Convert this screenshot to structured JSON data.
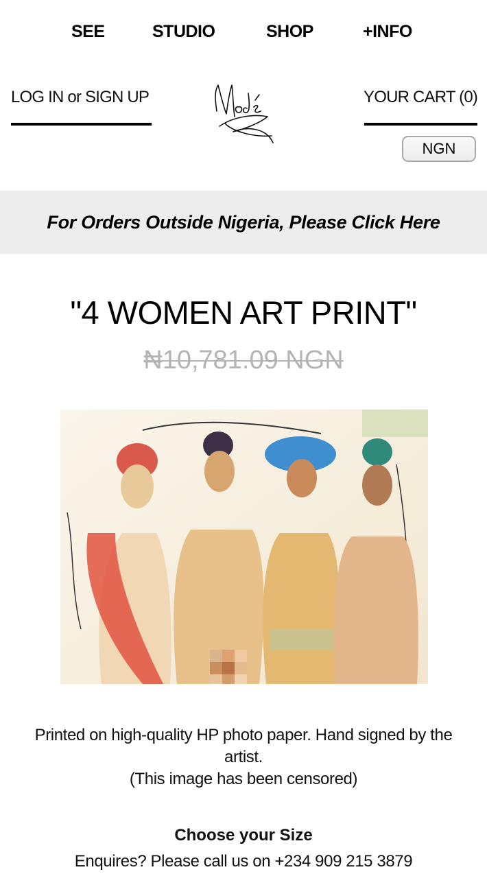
{
  "nav": {
    "see": "SEE",
    "studio": "STUDIO",
    "shop": "SHOP",
    "info": "+INFO"
  },
  "header": {
    "login": "LOG IN or SIGN UP",
    "cart": "YOUR CART (0)",
    "currency": "NGN"
  },
  "banner": {
    "text": "For Orders Outside Nigeria, Please Click Here"
  },
  "product": {
    "title": "\"4 WOMEN ART PRINT\"",
    "price": "₦10,781.09 NGN",
    "description_line1": "Printed on high-quality HP photo paper. Hand signed by the artist.",
    "description_line2": "(This image has been censored)",
    "size_label": "Choose your Size",
    "enquiry": "Enquires? Please call us on +234 909 215 3879"
  },
  "colors": {
    "banner_bg": "#ededed",
    "price_gray": "#b4b4b4",
    "currency_border": "#a9a9a9"
  }
}
